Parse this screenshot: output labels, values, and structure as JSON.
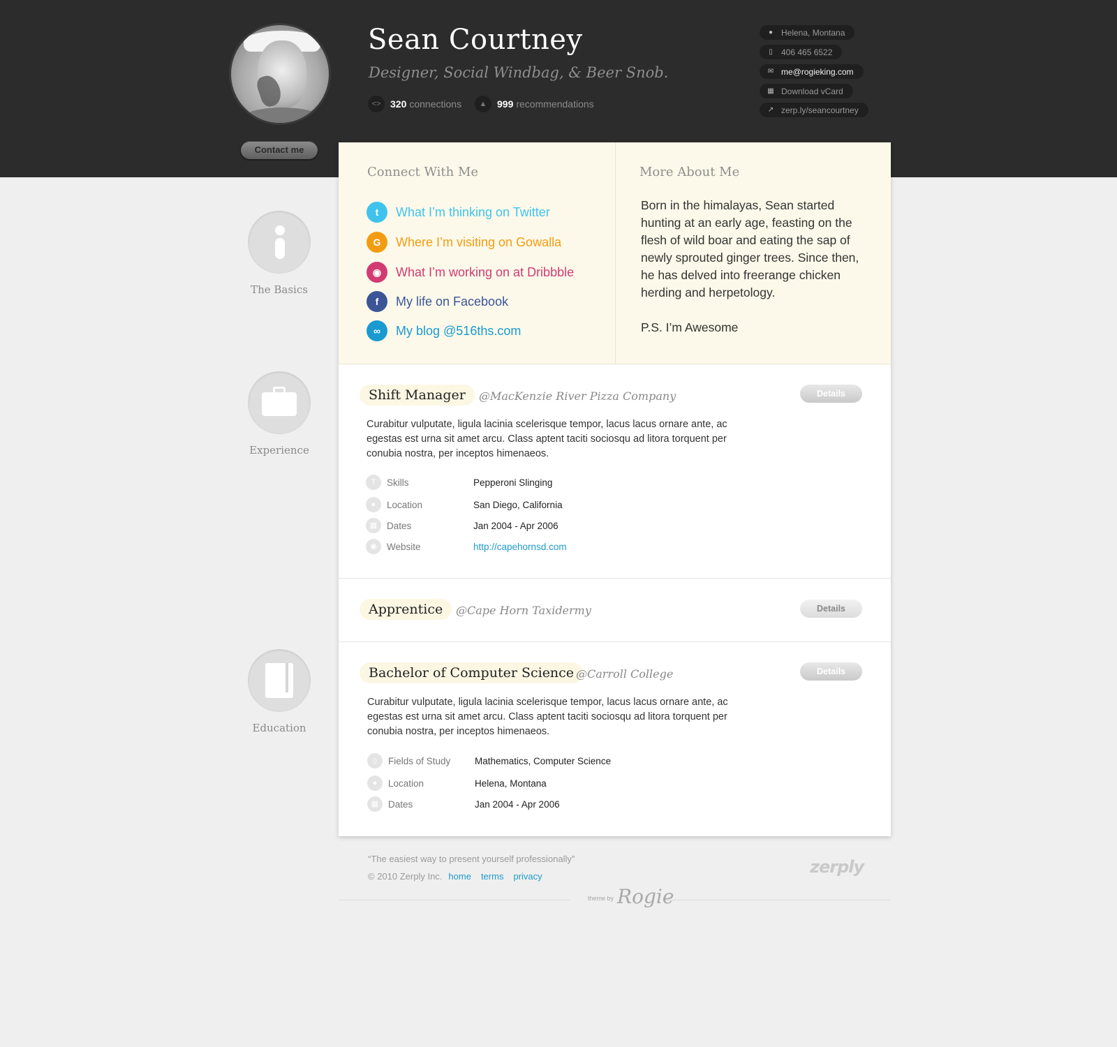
{
  "profile": {
    "name": "Sean Courtney",
    "tagline": "Designer, Social Windbag, & Beer Snob.",
    "contact_button": "Contact me",
    "stats": [
      {
        "value": "320",
        "label": "connections",
        "icon": "connections-icon"
      },
      {
        "value": "999",
        "label": "recommendations",
        "icon": "thumbs-up-icon"
      }
    ],
    "info": [
      {
        "text": "Helena, Montana",
        "icon": "location-pin-icon"
      },
      {
        "text": "406 465 6522",
        "icon": "phone-icon"
      },
      {
        "text": "me@rogieking.com",
        "icon": "mail-icon"
      },
      {
        "text": "Download vCard",
        "icon": "vcard-icon"
      },
      {
        "text": "zerp.ly/seancourtney",
        "icon": "external-link-icon"
      }
    ]
  },
  "sections": {
    "basics": "The Basics",
    "experience": "Experience",
    "education": "Education"
  },
  "connect": {
    "title": "Connect With Me",
    "links": [
      {
        "text": "What I’m thinking on Twitter",
        "icon": "twitter-icon",
        "color": "#3fc3ec"
      },
      {
        "text": "Where I’m visiting on Gowalla",
        "icon": "gowalla-icon",
        "color": "#f39c12"
      },
      {
        "text": "What I’m working on at Dribbble",
        "icon": "dribbble-icon",
        "color": "#d13b72"
      },
      {
        "text": "My life on Facebook",
        "icon": "facebook-icon",
        "color": "#3b5597"
      },
      {
        "text": "My blog @516ths.com",
        "icon": "link-icon",
        "color": "#1a9ad0"
      }
    ]
  },
  "about": {
    "title": "More About Me",
    "paragraph": "Born in the himalayas, Sean started hunting at an early age, feasting on the flesh of wild boar and eating the sap of newly sprouted ginger trees. Since then, he has delved into freerange chicken herding and herpetology.",
    "ps": "P.S. I’m Awesome"
  },
  "experience": [
    {
      "role": "Shift Manager",
      "org": "@MacKenzie River Pizza Company",
      "details": "Details",
      "description": "Curabitur vulputate, ligula lacinia scelerisque tempor, lacus lacus ornare ante, ac egestas est urna sit amet arcu. Class aptent taciti sociosqu ad litora torquent per conubia nostra, per inceptos himenaeos.",
      "rows": [
        {
          "label": "Skills",
          "value": "Pepperoni Slinging",
          "icon": "skills-icon"
        },
        {
          "label": "Location",
          "value": "San Diego, California",
          "icon": "location-pin-icon"
        },
        {
          "label": "Dates",
          "value": "Jan 2004 - Apr 2006",
          "icon": "calendar-icon"
        },
        {
          "label": "Website",
          "value": "http://capehornsd.com",
          "icon": "globe-icon"
        }
      ]
    },
    {
      "role": "Apprentice",
      "org": "@Cape Horn Taxidermy",
      "details": "Details"
    }
  ],
  "education": {
    "role": "Bachelor of Computer Science",
    "org": "@Carroll College",
    "details": "Details",
    "description": "Curabitur vulputate, ligula lacinia scelerisque tempor, lacus lacus ornare ante, ac egestas est urna sit amet arcu. Class aptent taciti sociosqu ad litora torquent per conubia nostra, per inceptos himenaeos.",
    "rows": [
      {
        "label": "Fields of Study",
        "value": "Mathematics, Computer Science",
        "icon": "book-icon"
      },
      {
        "label": "Location",
        "value": "Helena, Montana",
        "icon": "location-pin-icon"
      },
      {
        "label": "Dates",
        "value": "Jan 2004 - Apr 2006",
        "icon": "calendar-icon"
      }
    ]
  },
  "footer": {
    "quote": "“The easiest way to present yourself professionally”",
    "copyright": "© 2010 Zerply Inc.",
    "links": [
      "home",
      "terms",
      "privacy"
    ],
    "logo": "zerply",
    "theme_by": "theme by",
    "signature": "Rogie"
  }
}
